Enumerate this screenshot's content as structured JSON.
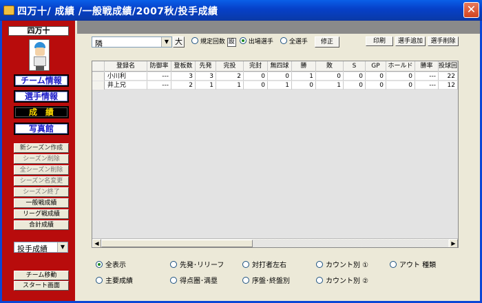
{
  "window": {
    "title": "四万十/ 成績 /一般戦成績/2007秋/投手成績",
    "close_glyph": "✕"
  },
  "sidebar": {
    "team_name": "四万十",
    "nav": [
      {
        "label": "チーム情報",
        "selected": false
      },
      {
        "label": "選手情報",
        "selected": false
      },
      {
        "label": "成　績",
        "selected": true
      },
      {
        "label": "写真館",
        "selected": false
      }
    ],
    "actions": [
      {
        "label": "新シーズン作成",
        "state": "normal"
      },
      {
        "label": "シーズン削除",
        "state": "dim"
      },
      {
        "label": "全シーズン削除",
        "state": "dim"
      },
      {
        "label": "シーズン名変更",
        "state": "dim"
      },
      {
        "label": "シーズン終了",
        "state": "dim"
      },
      {
        "label": "一般戦成績",
        "state": "strong"
      },
      {
        "label": "リーグ戦成績",
        "state": "strong"
      },
      {
        "label": "合計成績",
        "state": "strong"
      }
    ],
    "stat_select": "投手成績",
    "footer_buttons": [
      "チーム移動",
      "スタート画面"
    ]
  },
  "toolbar": {
    "filter_combo_value": "隣",
    "size_button": "大",
    "radios": [
      {
        "label": "規定回数",
        "checked": false
      },
      {
        "label": "出場選手",
        "checked": true
      },
      {
        "label": "全選手",
        "checked": false
      }
    ],
    "set_button": "設",
    "modify_button": "修正",
    "print_button": "印刷",
    "add_player_button": "選手追加",
    "delete_player_button": "選手削除"
  },
  "table": {
    "columns": [
      "登録名",
      "防御率",
      "登板数",
      "先発",
      "完投",
      "完封",
      "無四球",
      "勝",
      "敗",
      "S",
      "GP",
      "ホールド",
      "勝率",
      "投球回"
    ],
    "rows": [
      [
        "小川利",
        "---",
        "3",
        "3",
        "2",
        "0",
        "0",
        "1",
        "0",
        "0",
        "0",
        "0",
        "---",
        "22"
      ],
      [
        "井上兄",
        "---",
        "2",
        "1",
        "1",
        "0",
        "1",
        "0",
        "1",
        "0",
        "0",
        "0",
        "---",
        "12"
      ]
    ]
  },
  "view_options": {
    "row1": [
      {
        "label": "全表示",
        "checked": true
      },
      {
        "label": "先発･リリーフ",
        "checked": false
      },
      {
        "label": "対打者左右",
        "checked": false
      },
      {
        "label": "カウント別 ①",
        "checked": false
      },
      {
        "label": "アウト 種類",
        "checked": false
      }
    ],
    "row2": [
      {
        "label": "主要成績",
        "checked": false
      },
      {
        "label": "得点圏･満塁",
        "checked": false
      },
      {
        "label": "序盤･終盤別",
        "checked": false
      },
      {
        "label": "カウント別 ②",
        "checked": false
      }
    ]
  }
}
